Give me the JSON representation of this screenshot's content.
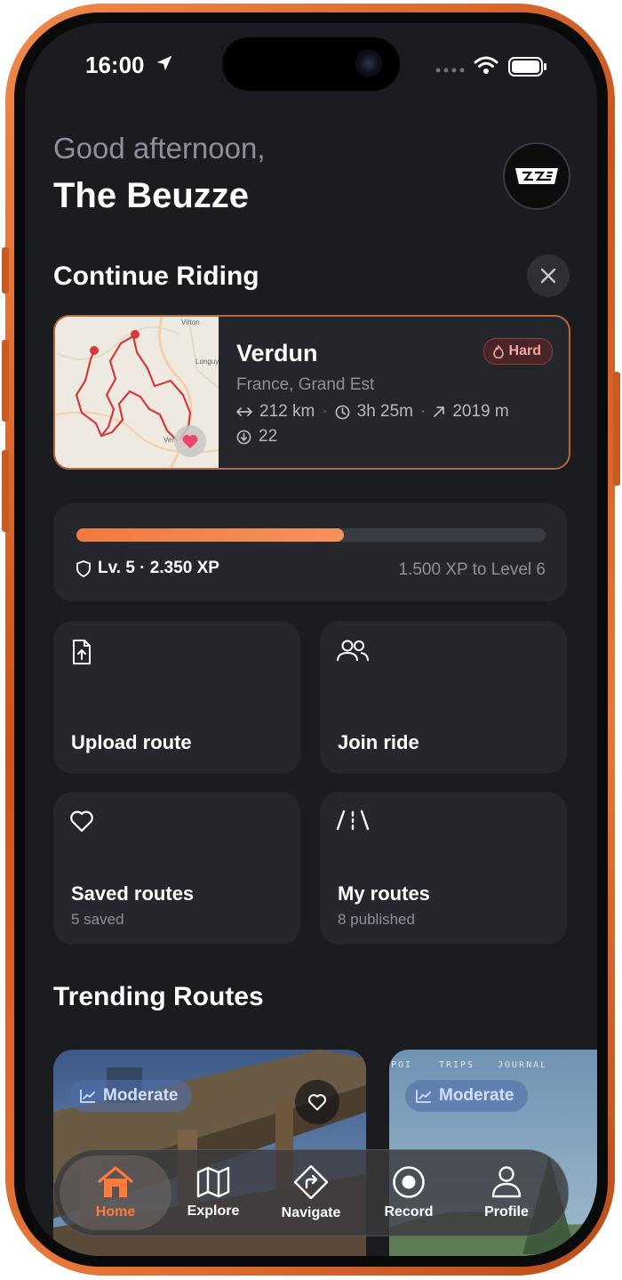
{
  "status_bar": {
    "time": "16:00"
  },
  "header": {
    "greeting": "Good afternoon,",
    "user_name": "The Beuzze"
  },
  "continue_riding": {
    "title": "Continue Riding",
    "route": {
      "name": "Verdun",
      "location": "France, Grand Est",
      "difficulty": "Hard",
      "distance": "212 km",
      "duration": "3h 25m",
      "elevation": "2019 m",
      "downloads": "22"
    },
    "map_labels": {
      "top": "Virton",
      "right": "Longuy",
      "bottom": "Ver"
    }
  },
  "xp": {
    "level_text": "Lv. 5 · 2.350 XP",
    "next_text": "1.500 XP to Level 6",
    "progress": 0.57
  },
  "actions": {
    "upload": {
      "label": "Upload route"
    },
    "join": {
      "label": "Join ride"
    },
    "saved": {
      "label": "Saved routes",
      "sub": "5 saved"
    },
    "mine": {
      "label": "My routes",
      "sub": "8 published"
    }
  },
  "trending": {
    "title": "Trending Routes",
    "cards": [
      {
        "difficulty": "Moderate"
      },
      {
        "difficulty": "Moderate",
        "photo_text": [
          "POI",
          "TRIPS",
          "JOURNAL"
        ]
      }
    ]
  },
  "tabbar": {
    "home": "Home",
    "explore": "Explore",
    "navigate": "Navigate",
    "record": "Record",
    "profile": "Profile"
  },
  "colors": {
    "accent": "#ff7a3d",
    "background": "#1b1c20",
    "card": "#26272c",
    "hard_badge": "#4a2527",
    "moderate_badge": "#506eaa"
  }
}
